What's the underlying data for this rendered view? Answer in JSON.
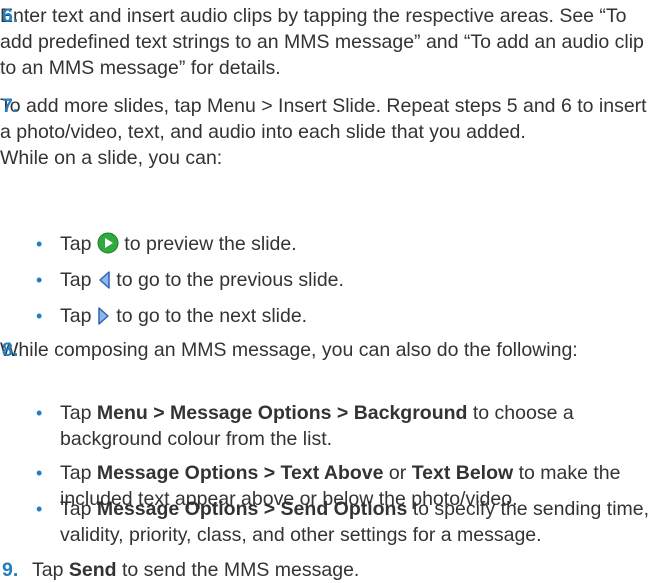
{
  "steps": [
    {
      "num": "6.",
      "text": "Enter text and insert audio clips by tapping the respective areas. See “To add predefined text strings to an MMS message” and “To add an audio clip to an MMS message” for details."
    },
    {
      "num": "7.",
      "text": "To add more slides, tap Menu > Insert Slide. Repeat steps 5 and 6 to insert a photo/video, text, and audio into each slide that you added.",
      "subtext": "While on a slide, you can:",
      "bullets": [
        {
          "tap": "Tap",
          "after": "to preview the slide.",
          "icon": "play-icon"
        },
        {
          "tap": "Tap",
          "after": "to go to the previous slide.",
          "icon": "previous-arrow-icon"
        },
        {
          "tap": "Tap",
          "after": "to go to the next slide.",
          "icon": "next-arrow-icon"
        }
      ]
    },
    {
      "num": "8.",
      "text": "While composing an MMS message, you can also do the following:",
      "bullets": [
        {
          "tap": "Tap",
          "bold1": "Menu > Message Options > Background",
          "after": "to choose a background colour from the list."
        },
        {
          "tap": "Tap",
          "bold1": "Message Options > Text Above",
          "mid": "or",
          "bold2": "Text Below",
          "after": "to make the included text appear above or below the photo/video."
        },
        {
          "tap": "Tap",
          "bold1": "Message Options > Send Options",
          "after": "to specify the sending time, validity, priority, class, and other settings for a message."
        }
      ]
    },
    {
      "num": "9.",
      "tap": "Tap",
      "bold": "Send",
      "after": "to send the MMS message."
    }
  ],
  "colors": {
    "accent": "#1f7fc0",
    "text": "#333333",
    "icon_green": "#2faa3c"
  }
}
